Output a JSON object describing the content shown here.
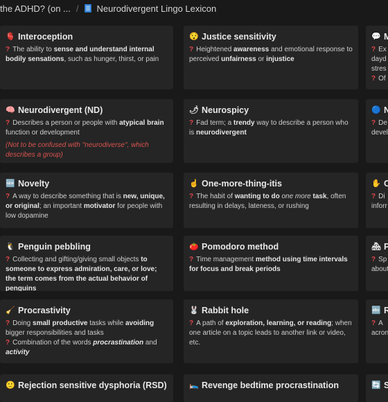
{
  "breadcrumb": {
    "parent": "the ADHD? (on ...",
    "separator": "/",
    "current": "Neurodivergent Lingo Lexicon"
  },
  "cards": [
    {
      "title": "Interoception",
      "emoji": "🫀",
      "lines": [
        [
          "? ",
          "The ability to ",
          "sense and understand internal bodily sensations",
          ", such as hunger, thirst, or pain"
        ]
      ]
    },
    {
      "title": "Justice sensitivity",
      "emoji": "😯",
      "lines": [
        [
          "? ",
          "Heightened ",
          "awareness",
          " and emotional response to perceived ",
          "unfairness",
          " or ",
          "injustice"
        ]
      ]
    },
    {
      "title": "M",
      "emoji": "💬",
      "lines": [
        [
          "? ",
          "Ex"
        ],
        [
          "",
          "dayd"
        ],
        [
          "",
          "stres"
        ],
        [
          "? ",
          "Of"
        ]
      ]
    },
    {
      "title": "Neurodivergent (ND)",
      "emoji": "🧠",
      "lines": [
        [
          "? ",
          "Describes a person or people with ",
          "atypical brain",
          " function or development"
        ]
      ],
      "note": "(Not to be confused with \"neurodiverse\", which describes a group)"
    },
    {
      "title": "Neurospicy",
      "emoji": "🌶",
      "lines": [
        [
          "? ",
          "Fad term; a ",
          "trendy",
          " way to describe a person who is ",
          "neurodivergent"
        ]
      ]
    },
    {
      "title": "N",
      "emoji": "🔵",
      "lines": [
        [
          "? ",
          "De"
        ],
        [
          "",
          "devel"
        ]
      ]
    },
    {
      "title": "Novelty",
      "emoji": "🆕",
      "lines": [
        [
          "? ",
          "A way to describe something that is ",
          "new, unique, or original",
          "; an important ",
          "motivator",
          " for people with low dopamine"
        ]
      ]
    },
    {
      "title": "One-more-thing-itis",
      "emoji": "☝",
      "lines": [
        [
          "? ",
          "The habit of ",
          "wanting to do ",
          "one more",
          " task",
          ", often resulting in delays, lateness, or rushing"
        ]
      ]
    },
    {
      "title": "O",
      "emoji": "✋",
      "lines": [
        [
          "? ",
          "Di"
        ],
        [
          "",
          "inforr"
        ]
      ]
    },
    {
      "title": "Penguin pebbling",
      "emoji": "🐧",
      "lines": [
        [
          "? ",
          "Collecting and gifting/giving small objects",
          " to someone to express admiration, care, or love; the term comes from the actual behavior of penguins"
        ]
      ]
    },
    {
      "title": "Pomodoro method",
      "emoji": "🍅",
      "lines": [
        [
          "? ",
          "Time management",
          " method using time intervals for focus and break periods"
        ]
      ]
    },
    {
      "title": "P",
      "emoji": "🏘",
      "lines": [
        [
          "? ",
          "Sp"
        ],
        [
          "",
          "about"
        ]
      ]
    },
    {
      "title": "Procrastivity",
      "emoji": "🧹",
      "lines": [
        [
          "? ",
          "Doing ",
          "small productive",
          " tasks while ",
          "avoiding",
          " bigger responsibilities and tasks"
        ],
        [
          "? ",
          "Combination of the words ",
          "procrastination",
          " and ",
          "activity"
        ]
      ]
    },
    {
      "title": "Rabbit hole",
      "emoji": "🐰",
      "lines": [
        [
          "? ",
          "A path of ",
          "exploration, learning, or reading",
          "; when one article on a topic leads to another link or video, etc."
        ]
      ]
    },
    {
      "title": "R",
      "emoji": "🔤",
      "lines": [
        [
          "? ",
          "A"
        ],
        [
          "",
          "acron"
        ]
      ]
    },
    {
      "title": "Rejection sensitive dysphoria (RSD)",
      "emoji": "🙂",
      "lines": []
    },
    {
      "title": "Revenge bedtime procrastination",
      "emoji": "🛌",
      "lines": []
    },
    {
      "title": "S",
      "emoji": "🔄",
      "lines": []
    }
  ]
}
